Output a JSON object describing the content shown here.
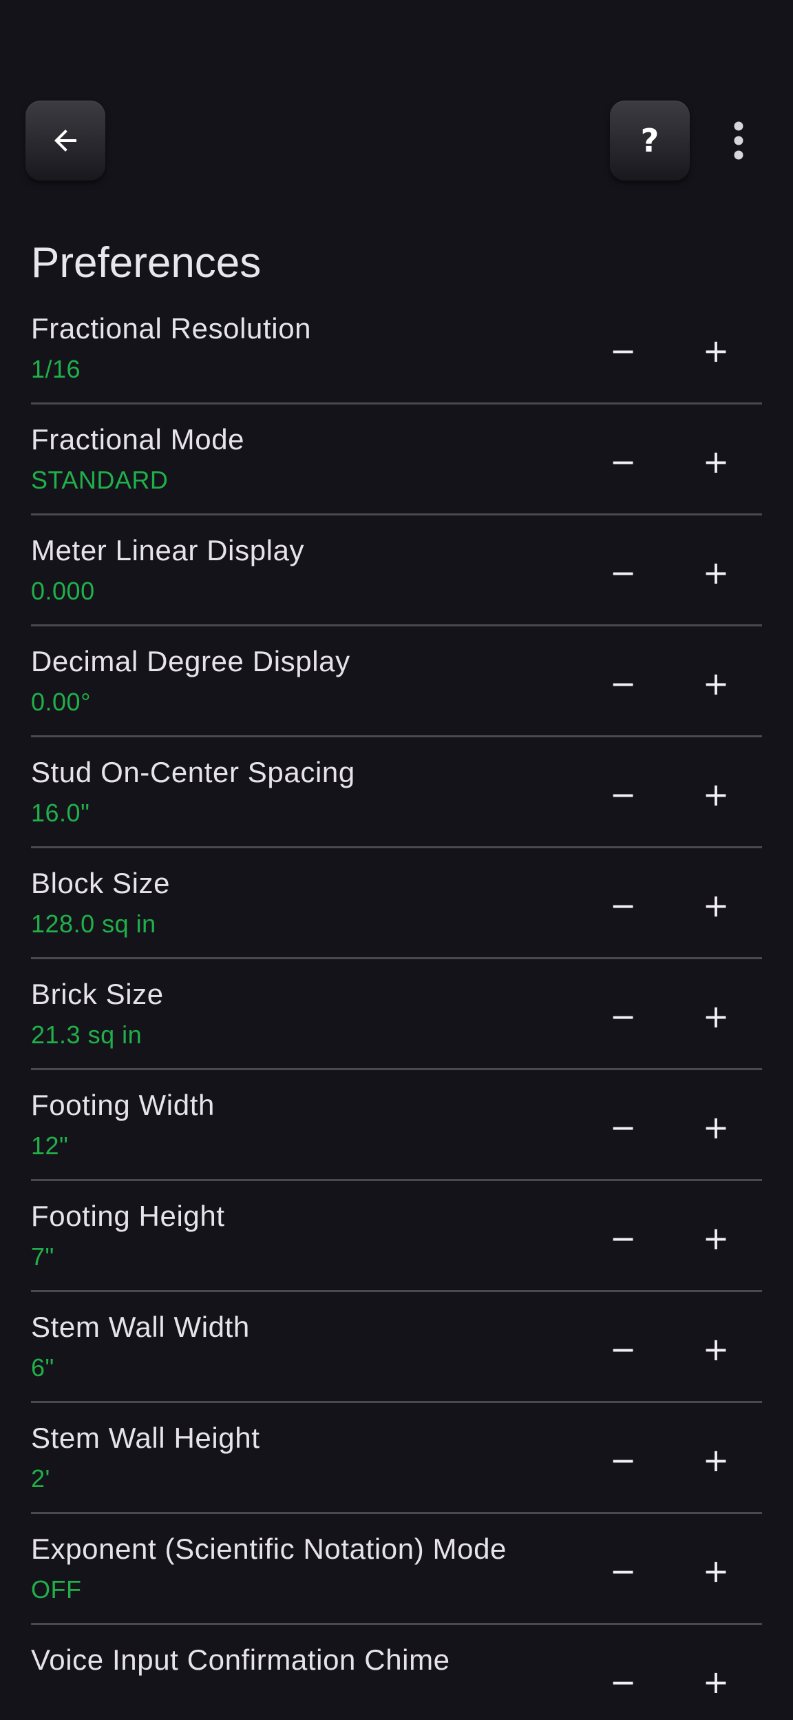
{
  "page": {
    "title": "Preferences",
    "help_label": "?",
    "colors": {
      "background": "#15131a",
      "value_text": "#1fb04a",
      "divider": "#4a4950"
    },
    "icons": {
      "back": "arrow-left-icon",
      "more": "more-vert-icon"
    }
  },
  "preferences": [
    {
      "label": "Fractional Resolution",
      "value": "1/16"
    },
    {
      "label": "Fractional Mode",
      "value": "STANDARD"
    },
    {
      "label": "Meter Linear Display",
      "value": "0.000"
    },
    {
      "label": "Decimal Degree Display",
      "value": "0.00°"
    },
    {
      "label": "Stud On-Center Spacing",
      "value": "16.0\""
    },
    {
      "label": "Block Size",
      "value": "128.0 sq in"
    },
    {
      "label": "Brick Size",
      "value": "21.3 sq in"
    },
    {
      "label": "Footing Width",
      "value": "12\""
    },
    {
      "label": "Footing Height",
      "value": "7\""
    },
    {
      "label": "Stem Wall Width",
      "value": "6\""
    },
    {
      "label": "Stem Wall Height",
      "value": "2'"
    },
    {
      "label": "Exponent (Scientific Notation) Mode",
      "value": "OFF"
    },
    {
      "label": "Voice Input Confirmation Chime",
      "value": ""
    }
  ],
  "stepper": {
    "decrement_label": "−",
    "increment_label": "+"
  }
}
